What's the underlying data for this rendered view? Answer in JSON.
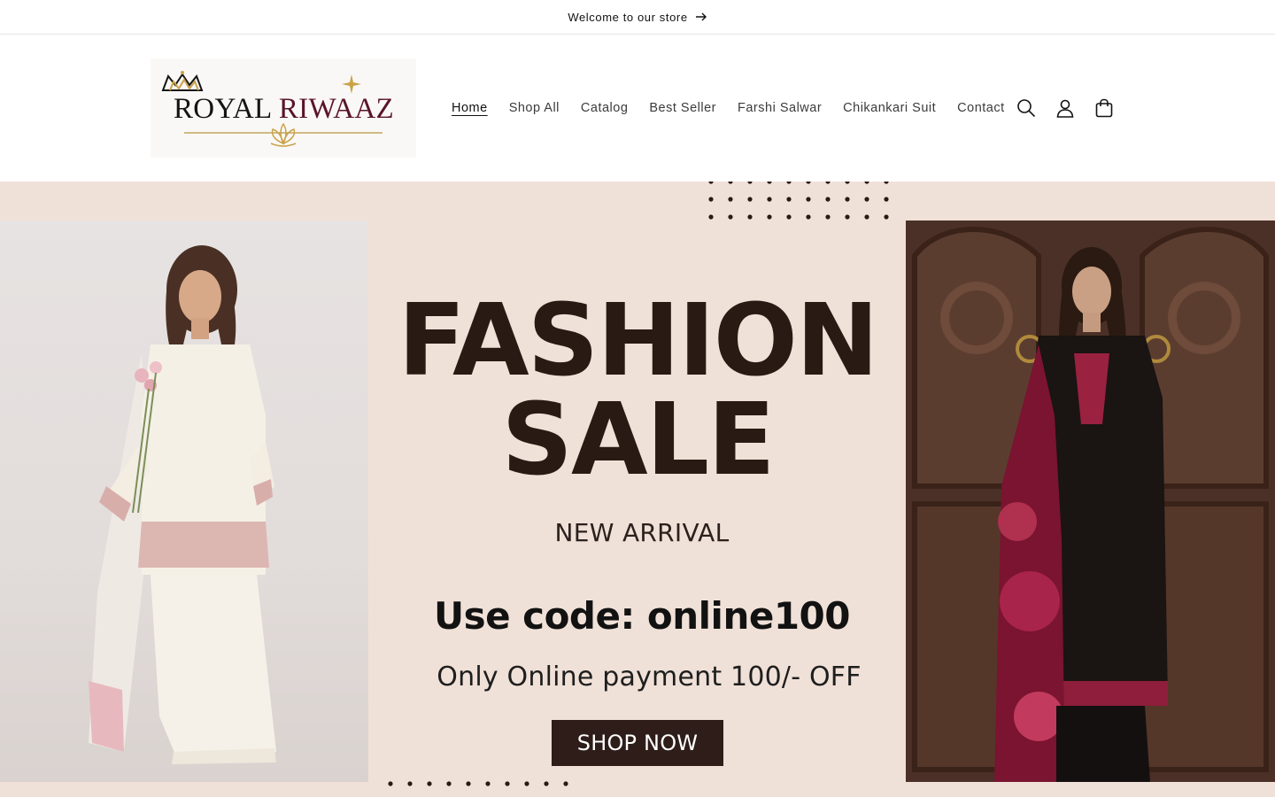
{
  "announcement": {
    "text": "Welcome to our store"
  },
  "logo": {
    "brand_part1": "ROYAL",
    "brand_part2": "RIWAAZ"
  },
  "nav": {
    "items": [
      {
        "label": "Home",
        "active": true
      },
      {
        "label": "Shop All"
      },
      {
        "label": "Catalog"
      },
      {
        "label": "Best Seller"
      },
      {
        "label": "Farshi Salwar"
      },
      {
        "label": "Chikankari Suit"
      },
      {
        "label": "Contact"
      }
    ]
  },
  "header_icons": [
    "search-icon",
    "account-icon",
    "cart-icon"
  ],
  "hero": {
    "headline_line1": "FASHION",
    "headline_line2": "SALE",
    "subheadline": "NEW ARRIVAL",
    "code_text": "Use code: online100",
    "offer_text": "Only Online payment 100/- OFF",
    "cta_label": "SHOP NOW"
  },
  "colors": {
    "hero_bg": "#f0e1d8",
    "headline": "#2a1a14",
    "cta_bg": "#2e1d18",
    "brand_accent": "#5a1428",
    "crown_gold": "#c9a24a"
  }
}
